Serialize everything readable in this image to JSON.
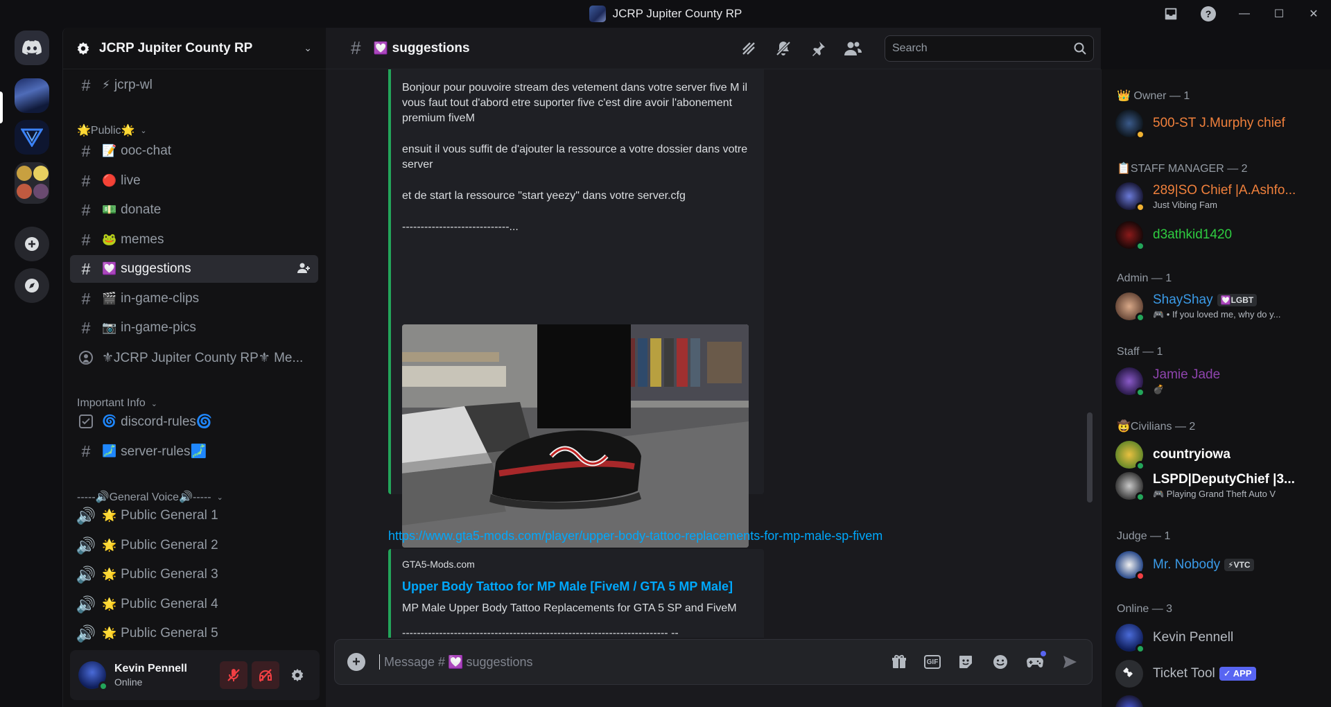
{
  "window": {
    "title": "JCRP Jupiter County RP"
  },
  "server": {
    "name": "JCRP Jupiter County RP"
  },
  "sidebar": {
    "channels": [
      {
        "emoji": "⚡",
        "name": "jcrp-wl"
      },
      {
        "emoji": "📝",
        "name": "ooc-chat"
      },
      {
        "emoji": "🔴",
        "name": "live"
      },
      {
        "emoji": "💵",
        "name": "donate"
      },
      {
        "emoji": "🐸",
        "name": "memes"
      },
      {
        "emoji": "💟",
        "name": "suggestions"
      },
      {
        "emoji": "🎬",
        "name": "in-game-clips"
      },
      {
        "emoji": "📷",
        "name": "in-game-pics"
      },
      {
        "emoji": "",
        "name": "⚜JCRP Jupiter County RP⚜ Me..."
      },
      {
        "emoji": "🌀",
        "name": "discord-rules🌀"
      },
      {
        "emoji": "🗾",
        "name": "server-rules🗾"
      },
      {
        "emoji": "🌟",
        "name": "Public General 1"
      },
      {
        "emoji": "🌟",
        "name": "Public General 2"
      },
      {
        "emoji": "🌟",
        "name": "Public General 3"
      },
      {
        "emoji": "🌟",
        "name": "Public General 4"
      },
      {
        "emoji": "🌟",
        "name": "Public General 5"
      }
    ],
    "categories": {
      "public": "🌟Public🌟",
      "important": "Important Info",
      "voice": "-----🔊General Voice🔊-----"
    }
  },
  "user": {
    "name": "Kevin Pennell",
    "status": "Online"
  },
  "channel": {
    "emoji": "💟",
    "name": "suggestions"
  },
  "search": {
    "placeholder": "Search"
  },
  "message": {
    "embed1": {
      "p1": "Bonjour pour pouvoire stream des vetement dans votre server five M il vous faut tout d'abord etre suporter five c'est dire avoir l'abonement premium fiveM",
      "p2": "ensuit il vous suffit de d'ajouter la ressource a votre dossier dans votre server",
      "p3": "et de start la ressource \"start yeezy\" dans votre server.cfg",
      "p4": "-----------------------------..."
    },
    "link": "https://www.gta5-mods.com/player/upper-body-tattoo-replacements-for-mp-male-sp-fivem",
    "embed2": {
      "provider": "GTA5-Mods.com",
      "title": "Upper Body Tattoo for MP Male [FiveM / GTA 5 MP Male]",
      "description": "MP Male Upper Body Tattoo Replacements for GTA 5 SP and FiveM",
      "dashes": "------------------------------------------------------------------------ --"
    }
  },
  "composer": {
    "placeholder_prefix": "Message #",
    "placeholder_emoji": "💟",
    "placeholder_channel": "suggestions",
    "gif_label": "GIF"
  },
  "members": {
    "groups": [
      {
        "label": "👑 Owner — 1"
      },
      {
        "label": "📋STAFF MANAGER — 2"
      },
      {
        "label": "Admin — 1"
      },
      {
        "label": "Staff — 1"
      },
      {
        "label": "🤠Civilians — 2"
      },
      {
        "label": "Judge — 1"
      },
      {
        "label": "Online — 3"
      }
    ],
    "list": [
      {
        "name": "500-ST J.Murphy chief",
        "color": "#f0803c",
        "sub": ""
      },
      {
        "name": "289|SO Chief |A.Ashfo...",
        "color": "#f0803c",
        "sub": "Just Vibing Fam"
      },
      {
        "name": "d3athkid1420",
        "color": "#2ecc40",
        "sub": ""
      },
      {
        "name": "ShayShay",
        "color": "#3b9be8",
        "tag": "💟LGBT",
        "sub": "🎮 • If you loved me, why do y..."
      },
      {
        "name": "Jamie Jade",
        "color": "#8e44ad",
        "sub": "💣"
      },
      {
        "name": "countryiowa",
        "color": "#ffffff",
        "sub": ""
      },
      {
        "name": "LSPD|DeputyChief |3...",
        "color": "#ffffff",
        "sub": "🎮 Playing Grand Theft Auto V"
      },
      {
        "name": "Mr. Nobody",
        "color": "#3b9be8",
        "tag": "⚡VTC",
        "sub": ""
      },
      {
        "name": "Kevin Pennell",
        "color": "#b5bac1",
        "sub": ""
      },
      {
        "name": "Ticket Tool",
        "color": "#b5bac1",
        "apptag": "✓ APP",
        "sub": ""
      }
    ]
  }
}
